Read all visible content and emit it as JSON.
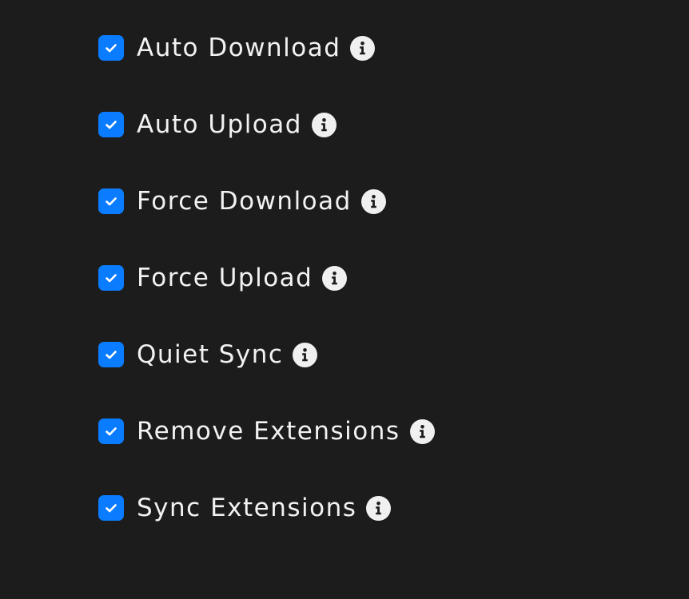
{
  "settings": {
    "items": [
      {
        "label": "Auto Download",
        "checked": true,
        "info_icon": "info-icon"
      },
      {
        "label": "Auto Upload",
        "checked": true,
        "info_icon": "info-icon"
      },
      {
        "label": "Force Download",
        "checked": true,
        "info_icon": "info-icon"
      },
      {
        "label": "Force Upload",
        "checked": true,
        "info_icon": "info-icon"
      },
      {
        "label": "Quiet Sync",
        "checked": true,
        "info_icon": "info-icon"
      },
      {
        "label": "Remove Extensions",
        "checked": true,
        "info_icon": "info-icon"
      },
      {
        "label": "Sync Extensions",
        "checked": true,
        "info_icon": "info-icon"
      }
    ]
  },
  "colors": {
    "background": "#1c1c1c",
    "accent": "#0a7cff",
    "text": "#f2f2f2",
    "info_icon_bg": "#f0f0f0"
  }
}
